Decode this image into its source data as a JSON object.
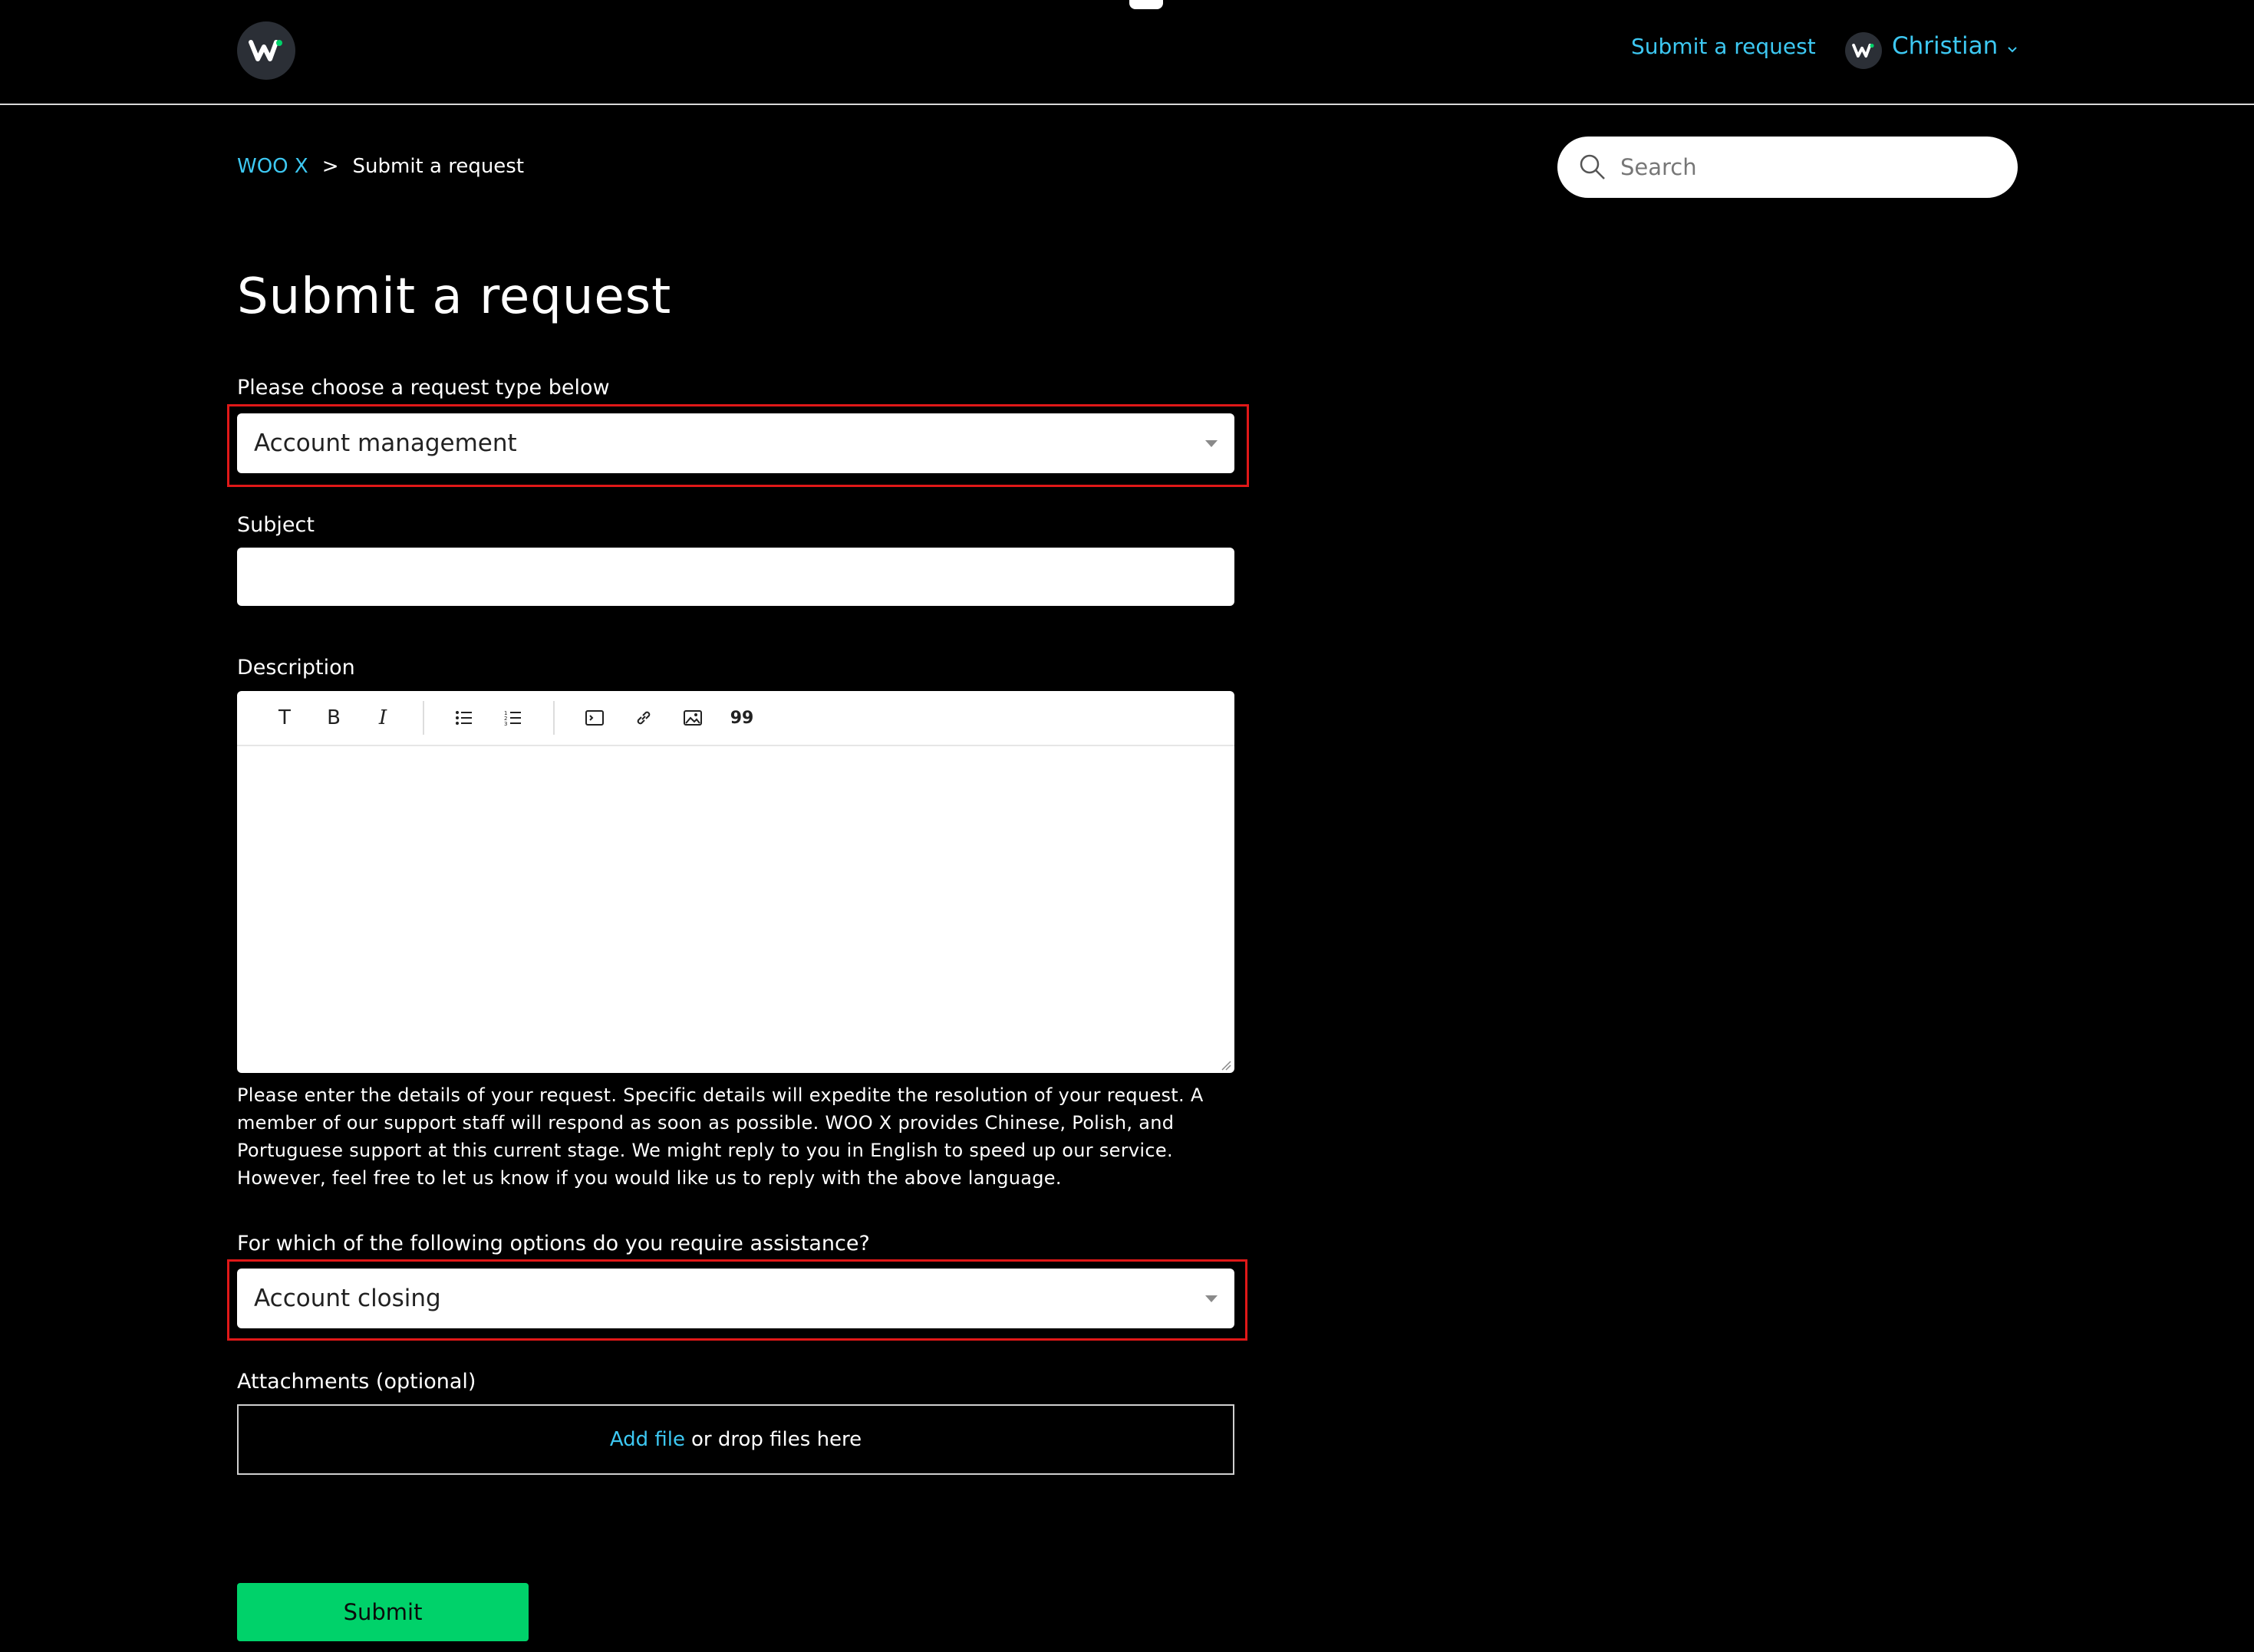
{
  "header": {
    "logo_icon": "woo-x-logo-icon",
    "submit_request_link": "Submit a request",
    "user_name": "Christian",
    "user_menu_icon": "chevron-down-icon",
    "accent_color": "#3dc8f2"
  },
  "breadcrumb": {
    "home": "WOO X",
    "separator": ">",
    "current": "Submit a request"
  },
  "search": {
    "placeholder": "Search",
    "icon": "search-icon"
  },
  "page": {
    "title": "Submit a request"
  },
  "form": {
    "request_type": {
      "label": "Please choose a request type below",
      "value": "Account management",
      "highlighted": true
    },
    "subject": {
      "label": "Subject",
      "value": ""
    },
    "description": {
      "label": "Description",
      "toolbar": [
        {
          "name": "text-style-icon",
          "glyph": "T"
        },
        {
          "name": "bold-icon",
          "glyph": "B"
        },
        {
          "name": "italic-icon",
          "glyph": "I"
        },
        {
          "name": "bulleted-list-icon",
          "glyph": ""
        },
        {
          "name": "numbered-list-icon",
          "glyph": ""
        },
        {
          "name": "code-block-icon",
          "glyph": ""
        },
        {
          "name": "link-icon",
          "glyph": ""
        },
        {
          "name": "image-icon",
          "glyph": ""
        },
        {
          "name": "quote-icon",
          "glyph": "99"
        }
      ],
      "value": "",
      "help_text": "Please enter the details of your request. Specific details will expedite the resolution of your request. A member of our support staff will respond as soon as possible. WOO X provides Chinese, Polish, and Portuguese support at this current stage. We might reply to you in English to speed up our service. However, feel free to let us know if you would like us to reply with the above language."
    },
    "assistance": {
      "label": "For which of the following options do you require assistance?",
      "value": "Account closing",
      "highlighted": true
    },
    "attachments": {
      "label": "Attachments (optional)",
      "add_file": "Add file",
      "drop_text": "or drop files here"
    },
    "submit_label": "Submit",
    "submit_color": "#00d26a",
    "highlight_color": "#e01818"
  }
}
